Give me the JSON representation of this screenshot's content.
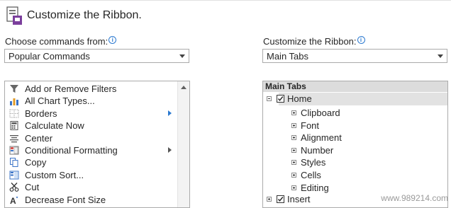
{
  "header": {
    "title": "Customize the Ribbon.",
    "icon": "ribbon-customize-icon"
  },
  "left": {
    "label": "Choose commands from:",
    "combo_value": "Popular Commands",
    "commands": [
      {
        "label": "Add or Remove Filters",
        "icon": "filter-icon",
        "submenu": false
      },
      {
        "label": "All Chart Types...",
        "icon": "chart-icon",
        "submenu": false
      },
      {
        "label": "Borders",
        "icon": "borders-icon",
        "submenu": true
      },
      {
        "label": "Calculate Now",
        "icon": "calculator-icon",
        "submenu": false
      },
      {
        "label": "Center",
        "icon": "align-center-icon",
        "submenu": false
      },
      {
        "label": "Conditional Formatting",
        "icon": "conditional-formatting-icon",
        "submenu": true
      },
      {
        "label": "Copy",
        "icon": "copy-icon",
        "submenu": false
      },
      {
        "label": "Custom Sort...",
        "icon": "sort-icon",
        "submenu": false
      },
      {
        "label": "Cut",
        "icon": "scissors-icon",
        "submenu": false
      },
      {
        "label": "Decrease Font Size",
        "icon": "decrease-font-icon",
        "submenu": false
      }
    ]
  },
  "right": {
    "label": "Customize the Ribbon:",
    "combo_value": "Main Tabs",
    "tree_header": "Main Tabs",
    "home_label": "Home",
    "home_groups": [
      "Clipboard",
      "Font",
      "Alignment",
      "Number",
      "Styles",
      "Cells",
      "Editing"
    ],
    "insert_label": "Insert"
  },
  "watermark": "www.989214.com",
  "colors": {
    "accent": "#2b79d0",
    "selection": "#e2e2e2",
    "header_bg": "#dcdcdc"
  }
}
